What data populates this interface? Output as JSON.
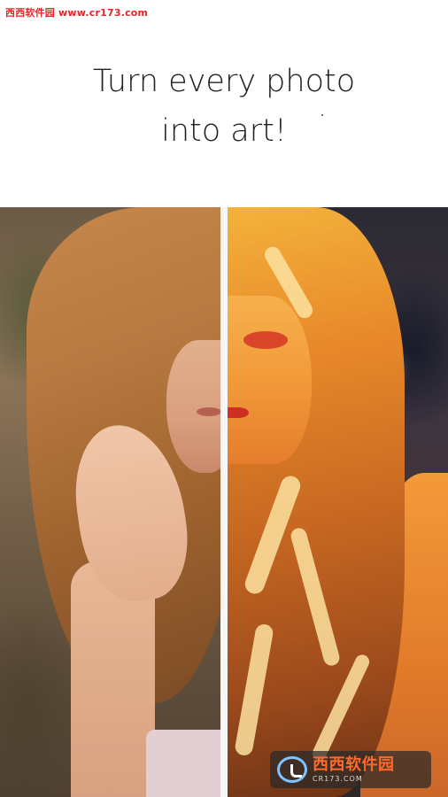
{
  "watermark": {
    "top_text": "西西软件园 www.cr173.com",
    "badge_title": "西西软件园",
    "badge_subtitle": "CR173.COM"
  },
  "headline": {
    "line1": "Turn every photo",
    "line2": "into art!"
  },
  "comparison": {
    "left_label": "original-photo",
    "right_label": "art-filtered-photo"
  },
  "colors": {
    "headline_text": "#222222",
    "watermark_red": "#e0262b",
    "badge_orange": "#ff6a2b",
    "divider": "#f7f7f7"
  }
}
